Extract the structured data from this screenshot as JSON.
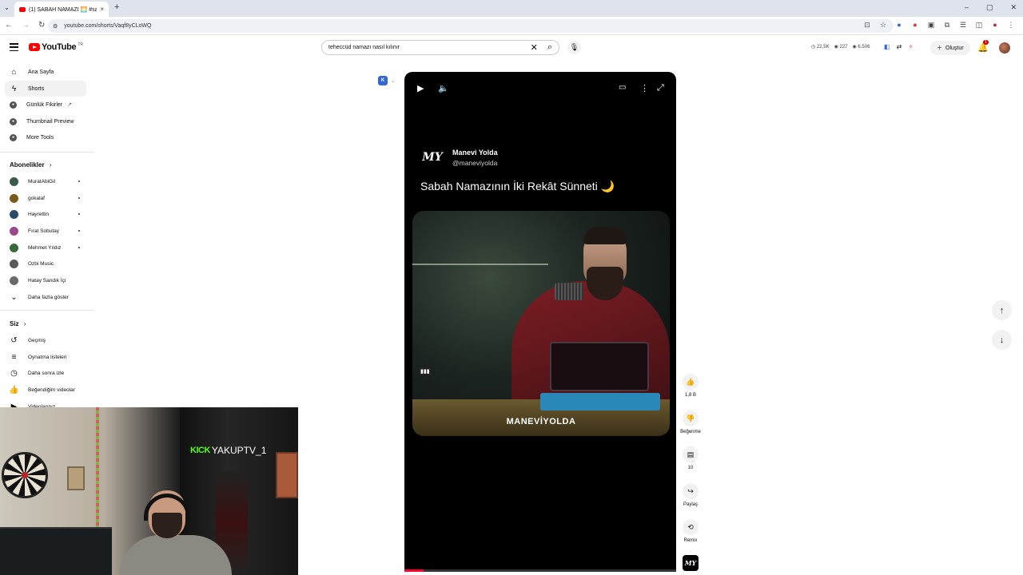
{
  "browser": {
    "tab_title": "(1) SABAH NAMAZI 🌅 #sabah",
    "tab_close": "×",
    "new_tab": "+",
    "url": "youtube.com/shorts/Vaqf8yCLoWQ",
    "win_min": "–",
    "win_max": "▢",
    "win_close": "✕"
  },
  "header": {
    "logo_word": "YouTube",
    "logo_sup": "TR",
    "search_value": "teheccüd namazı nasıl kılınır",
    "stat_views": "◷ 22,5K",
    "stat_eye": "◉ 227",
    "stat_subs": "◉ 6.506",
    "create_label": "Oluştur",
    "notif_count": "1"
  },
  "sidebar": {
    "main": [
      {
        "label": "Ana Sayfa",
        "icon": "⌂"
      },
      {
        "label": "Shorts",
        "icon": "ϟ"
      },
      {
        "label": "Günlük Fikirler",
        "icon": "●"
      },
      {
        "label": "Thumbnail Preview",
        "icon": "●"
      },
      {
        "label": "More Tools",
        "icon": "●"
      }
    ],
    "subs_heading": "Abonelikler",
    "subs": [
      {
        "label": "MuratAbiGil",
        "color": "#3a5a4a"
      },
      {
        "label": "gokalaf",
        "color": "#7a5a1a"
      },
      {
        "label": "Hayrettin",
        "color": "#2a4a6a"
      },
      {
        "label": "Fırat Sobutay",
        "color": "#9a4a8a"
      },
      {
        "label": "Mehmet Yıldız",
        "color": "#3a6a3a"
      },
      {
        "label": "Ozbi Music",
        "color": "#5a5a5a"
      },
      {
        "label": "Hatay Sandık İçi",
        "color": "#6a6a6a"
      }
    ],
    "show_more": "Daha fazla göster",
    "you_heading": "Siz",
    "you": [
      {
        "label": "Geçmiş",
        "icon": "↺"
      },
      {
        "label": "Oynatma listeleri",
        "icon": "≡"
      },
      {
        "label": "Daha sonra izle",
        "icon": "◷"
      },
      {
        "label": "Beğendiğim videolar",
        "icon": "👍"
      },
      {
        "label": "Videolarınız",
        "icon": "▶"
      }
    ]
  },
  "short": {
    "creator_name": "Manevi Yolda",
    "creator_handle": "@maneviyolda",
    "logo_text": "MY",
    "title": "Sabah Namazının İki Rekât Sünneti 🌙",
    "watermark": "MANEVİYOLDA",
    "progress": 0.07
  },
  "actions": {
    "like": "1,8 B",
    "dislike": "Beğenme",
    "comments": "10",
    "share": "Paylaş",
    "remix": "Remix"
  },
  "overlay": {
    "kick_brand": "KICK",
    "kick_user": "YAKUPTV_1"
  }
}
